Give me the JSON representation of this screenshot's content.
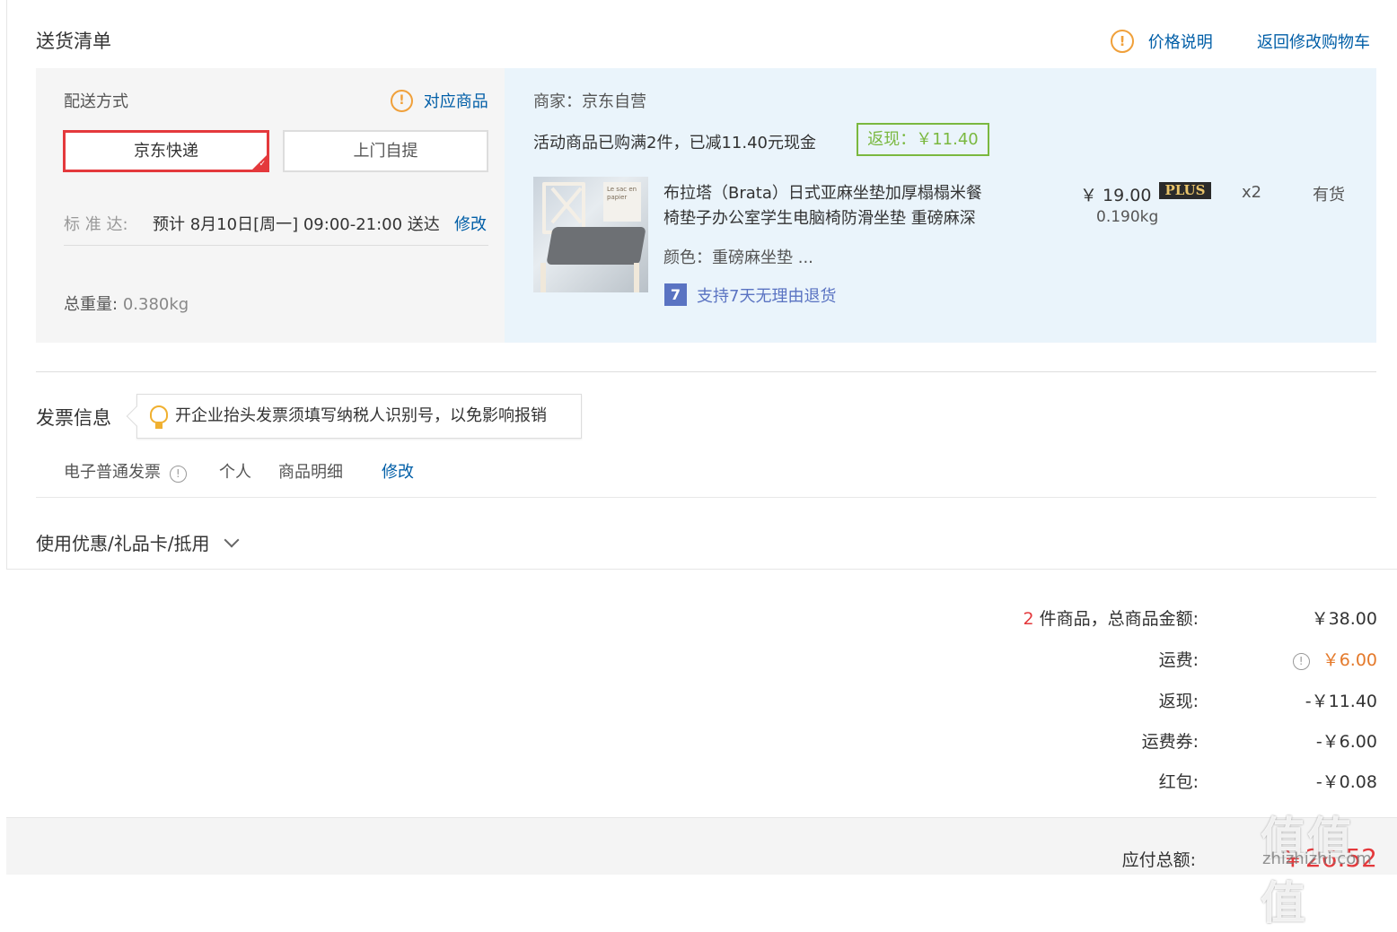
{
  "header": {
    "title": "送货清单",
    "price_note": "价格说明",
    "back_to_cart": "返回修改购物车"
  },
  "delivery": {
    "method_label": "配送方式",
    "related_products": "对应商品",
    "options": [
      "京东快递",
      "上门自提"
    ],
    "selected_option": "京东快递",
    "eta_label": "标 准 达:",
    "eta_value": "预计 8月10日[周一] 09:00-21:00 送达",
    "eta_edit": "修改",
    "total_weight_label": "总重量:",
    "total_weight_value": "0.380kg"
  },
  "shop": {
    "seller": "商家：京东自营",
    "promo": "活动商品已购满2件，已减11.40元现金",
    "cashback_tag": "返现：￥11.40"
  },
  "product": {
    "title_line1": "布拉塔（Brata）日式亚麻坐垫加厚榻榻米餐",
    "title_line2": "椅垫子办公室学生电脑椅防滑坐垫 重磅麻深",
    "color": "颜色：重磅麻坐垫 ...",
    "return_policy": "支持7天无理由退货",
    "return_icon": "7",
    "price": "￥ 19.00",
    "plus_badge": "PLUS",
    "weight": "0.190kg",
    "quantity": "x2",
    "stock": "有货",
    "image_paper_text": "Le sac en papier"
  },
  "invoice": {
    "title": "发票信息",
    "tip": "开企业抬头发票须填写纳税人识别号，以免影响报销",
    "type": "电子普通发票",
    "holder": "个人",
    "content": "商品明细",
    "edit": "修改"
  },
  "discount": {
    "label": "使用优惠/礼品卡/抵用"
  },
  "summary": {
    "item_count": "2",
    "items_label": "件商品，总商品金额:",
    "items_total": "￥38.00",
    "shipping_label": "运费:",
    "shipping_value": "￥6.00",
    "cashback_label": "返现:",
    "cashback_value": "-￥11.40",
    "shipping_coupon_label": "运费券:",
    "shipping_coupon_value": "-￥6.00",
    "red_packet_label": "红包:",
    "red_packet_value": "-￥0.08",
    "total_label": "应付总额:",
    "total_value": "￥26.52"
  },
  "watermark": {
    "logo": "值值值",
    "site": "zhizhizhi.com"
  },
  "colors": {
    "link": "#005ea7",
    "red": "#e4393c",
    "orange": "#e4792a",
    "green": "#7ab83f",
    "left_panel": "#f5f5f5",
    "right_panel": "#eaf4fb"
  }
}
